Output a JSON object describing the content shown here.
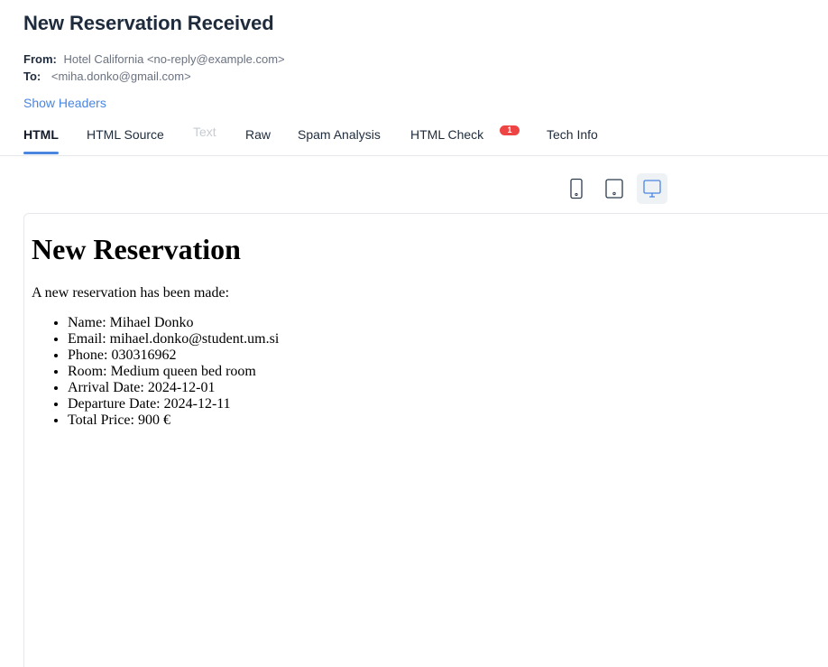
{
  "message": {
    "subject": "New Reservation Received",
    "from_label": "From:",
    "from_value": "Hotel California <no-reply@example.com>",
    "to_label": "To:",
    "to_value": "<miha.donko@gmail.com>",
    "show_headers": "Show Headers"
  },
  "tabs": [
    {
      "label": "HTML",
      "active": true
    },
    {
      "label": "HTML Source"
    },
    {
      "label": "Text",
      "disabled": true
    },
    {
      "label": "Raw"
    },
    {
      "label": "Spam Analysis"
    },
    {
      "label": "HTML Check",
      "badge": "1"
    },
    {
      "label": "Tech Info"
    }
  ],
  "device_toggle": {
    "options": [
      "mobile-icon",
      "tablet-icon",
      "desktop-icon"
    ],
    "selected": "desktop-icon"
  },
  "email_body": {
    "heading": "New Reservation",
    "intro": "A new reservation has been made:",
    "items": [
      "Name: Mihael Donko",
      "Email: mihael.donko@student.um.si",
      "Phone: 030316962",
      "Room: Medium queen bed room",
      "Arrival Date: 2024-12-01",
      "Departure Date: 2024-12-11",
      "Total Price: 900 €"
    ]
  },
  "colors": {
    "accent": "#4a86e0",
    "badge": "#ef4444",
    "title": "#1e2b3c",
    "muted": "#6b7280",
    "disabled_tab": "#c7ccd3"
  }
}
